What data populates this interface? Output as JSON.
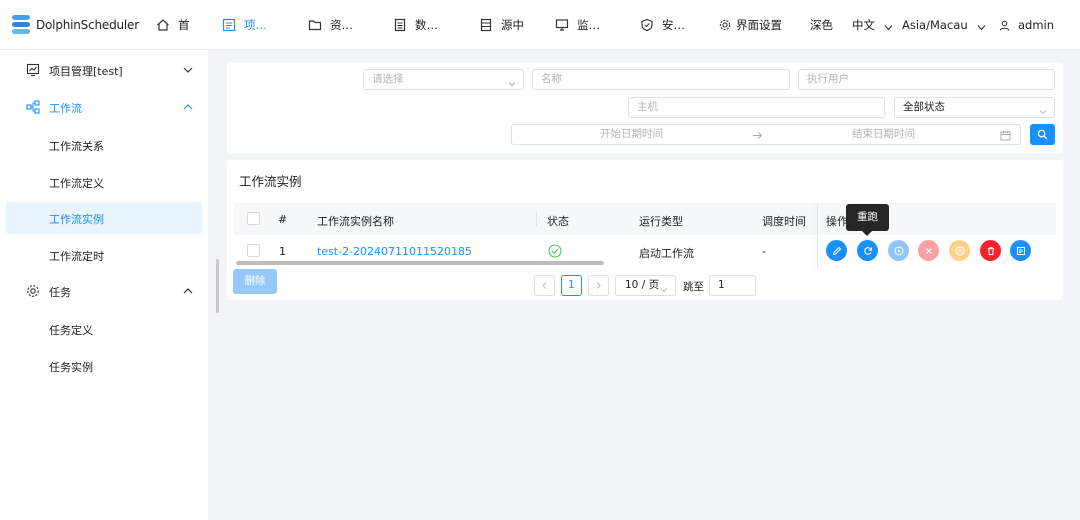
{
  "app": {
    "logo_text": "DolphinScheduler"
  },
  "nav": {
    "items": [
      {
        "label": "首",
        "icon": "home-icon"
      },
      {
        "label": "项…",
        "icon": "project-icon"
      },
      {
        "label": "资…",
        "icon": "folder-icon"
      },
      {
        "label": "数…",
        "icon": "datasource-icon"
      },
      {
        "label": "源中",
        "icon": "data-icon"
      },
      {
        "label": "监…",
        "icon": "monitor-icon"
      },
      {
        "label": "安…",
        "icon": "security-icon"
      }
    ],
    "active_index": 1,
    "ui_settings": "界面设置",
    "theme": "深色",
    "language": "中文",
    "timezone": "Asia/Macau",
    "user": "admin"
  },
  "sidebar": {
    "project": "项目管理[test]",
    "workflow_group": "工作流",
    "workflow_items": [
      "工作流关系",
      "工作流定义",
      "工作流实例",
      "工作流定时"
    ],
    "task_group": "任务",
    "task_items": [
      "任务定义",
      "任务实例"
    ],
    "active_item": "工作流实例"
  },
  "filter": {
    "select_placeholder": "请选择",
    "name_placeholder": "名称",
    "executor_placeholder": "执行用户",
    "host_placeholder": "主机",
    "status_value": "全部状态",
    "start_placeholder": "开始日期时间",
    "end_placeholder": "结束日期时间"
  },
  "table": {
    "title": "工作流实例",
    "columns": [
      "#",
      "工作流实例名称",
      "状态",
      "运行类型",
      "调度时间",
      "操作"
    ],
    "rows": [
      {
        "index": "1",
        "name": "test-2-20240711011520185",
        "status": "success",
        "run_type": "启动工作流",
        "schedule_time": "-"
      }
    ],
    "tooltip": "重跑",
    "actions": [
      {
        "name": "edit",
        "color": "#1890ff"
      },
      {
        "name": "rerun",
        "color": "#1890ff"
      },
      {
        "name": "recover",
        "color": "#8ec6fb"
      },
      {
        "name": "stop",
        "color": "#f9a1a1"
      },
      {
        "name": "pause",
        "color": "#fbd28a"
      },
      {
        "name": "delete",
        "color": "#f5232d"
      },
      {
        "name": "gantt",
        "color": "#1890ff"
      }
    ]
  },
  "footer": {
    "delete_label": "删除",
    "current_page": "1",
    "page_size": "10 / 页",
    "jump_label": "跳至",
    "jump_value": "1"
  }
}
